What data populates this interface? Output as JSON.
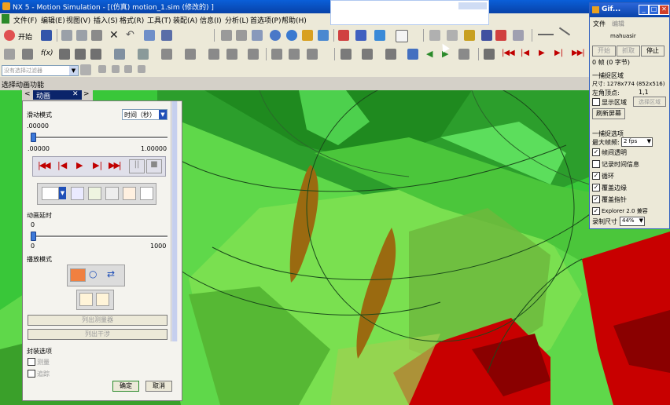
{
  "window": {
    "title": "NX 5 - Motion Simulation - [(仿真) motion_1.sim (修改的) ]",
    "nx_logo": "NX"
  },
  "menubar": {
    "items": [
      "文件(F)",
      "编辑(E)",
      "视图(V)",
      "插入(S)",
      "格式(R)",
      "工具(T)",
      "装配(A)",
      "信息(I)",
      "分析(L)",
      "首选项(P)",
      "帮助(H)"
    ]
  },
  "toolbar": {
    "start_label": "开始",
    "prompt": "选择动画功能",
    "filter_placeholder": "没有选择过滤器"
  },
  "dialog": {
    "tab_title": "动画",
    "scrub_mode_label": "滑动模式",
    "time_unit": "时间（秒）",
    "time_value": ".00000",
    "range_min": ".00000",
    "range_max": "1.00000",
    "delay_label": "动画延时",
    "delay_value": "0",
    "delay_min": "0",
    "delay_max": "1000",
    "play_mode_label": "播放模式",
    "list_measure": "列出测量器",
    "list_trace": "列出干涉",
    "envelope_label": "封装选项",
    "measure_check": "测量",
    "trace_check": "追踪",
    "ok": "确定",
    "cancel": "取消"
  },
  "gif": {
    "title": "Gif...",
    "menu": [
      "文件",
      "编辑"
    ],
    "user": "mahuasir",
    "btn_start": "开始",
    "btn_capture": "抓取",
    "btn_stop": "停止",
    "frames": "0 帧 (0 字节)",
    "capture_area": "一捕捉区域",
    "size": "尺寸: 1278x774 (852x516)",
    "topleft_label": "左角顶点:",
    "topleft_value": "1,1",
    "show_area": "显示区域",
    "select_area": "选择区域",
    "refresh": "刷新屏幕",
    "capture_opts": "一捕捉选项",
    "max_fps_label": "最大帧频:",
    "max_fps": "2 fps",
    "opt_transparent": "帧间透明",
    "opt_timeinfo": "记录时间信息",
    "opt_loop": "循环",
    "opt_edges": "覆盖边缘",
    "opt_cursor": "覆盖指针",
    "opt_ie": "Explorer 2.0 兼容",
    "rec_size_label": "录制尺寸",
    "rec_size": "44%"
  },
  "colors": {
    "titlebar": "#0842a8",
    "viewport_green": "#2fbf2f",
    "gear_red": "#c80000",
    "slot_brown": "#9a6a10"
  }
}
